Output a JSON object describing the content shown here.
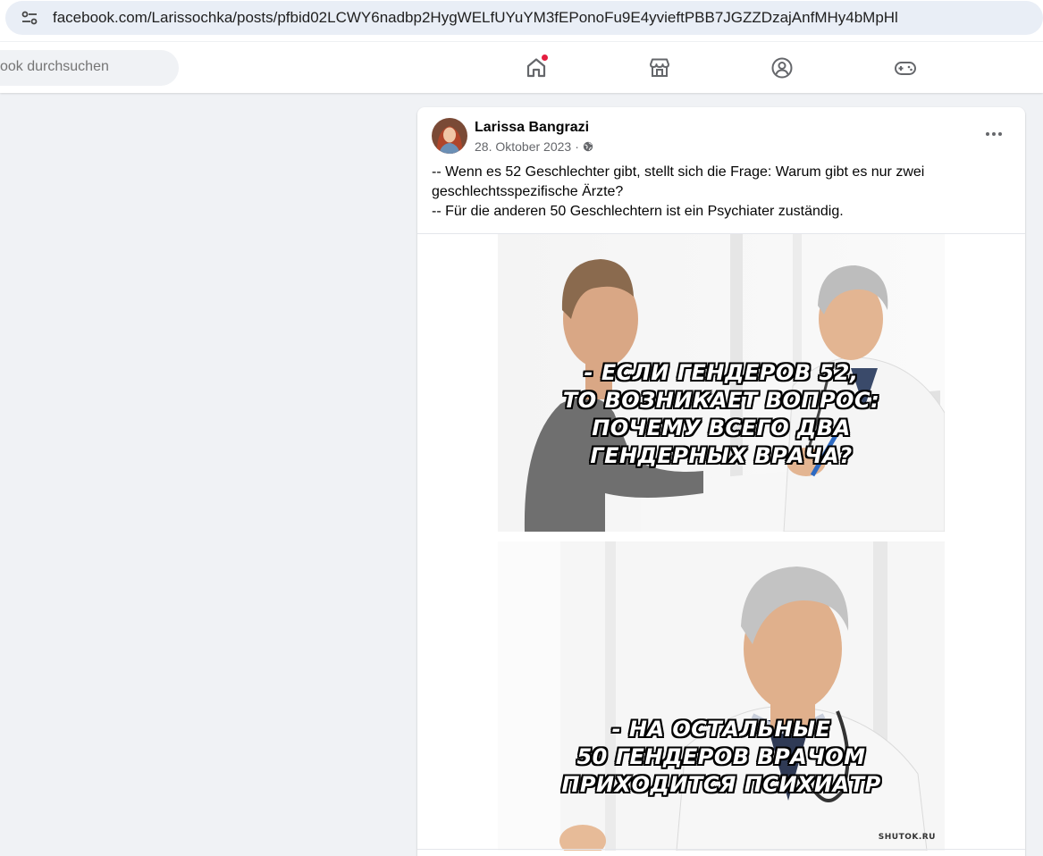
{
  "browser": {
    "url": "facebook.com/Larissochka/posts/pfbid02LCWY6nadbp2HygWELfUYuYM3fEPonoFu9E4yvieftPBB7JGZZDzajAnfMHy4bMpHl",
    "site_icon": "tune-icon"
  },
  "nav": {
    "search_placeholder": "ook durchsuchen",
    "items": [
      {
        "name": "home",
        "icon": "home-icon",
        "has_notification": true
      },
      {
        "name": "marketplace",
        "icon": "marketplace-icon"
      },
      {
        "name": "groups",
        "icon": "groups-icon"
      },
      {
        "name": "gaming",
        "icon": "gaming-icon"
      }
    ]
  },
  "post": {
    "author": "Larissa Bangrazi",
    "date": "28. Oktober 2023",
    "separator": "·",
    "privacy_icon": "globe-icon",
    "more_icon": "more-horizontal-icon",
    "text_lines": [
      "-- Wenn es 52 Geschlechter gibt, stellt sich die Frage: Warum gibt es nur zwei",
      "geschlechtsspezifische Ärzte?",
      "-- Für die anderen 50 Geschlechtern ist ein Psychiater zuständig."
    ],
    "image": {
      "panel1_lines": [
        "- ЕСЛИ ГЕНДЕРОВ 52,",
        "ТО ВОЗНИКАЕТ ВОПРОС:",
        "ПОЧЕМУ ВСЕГО ДВА",
        "ГЕНДЕРНЫХ ВРАЧА?"
      ],
      "panel2_lines": [
        "- НА ОСТАЛЬНЫЕ",
        "50 ГЕНДЕРОВ ВРАЧОМ",
        "ПРИХОДИТСЯ ПСИХИАТР"
      ],
      "watermark": "SHUTOK.RU"
    }
  },
  "colors": {
    "page_bg": "#f0f2f5",
    "card_bg": "#ffffff",
    "secondary_text": "#65676b",
    "notification": "#e41e3f"
  }
}
